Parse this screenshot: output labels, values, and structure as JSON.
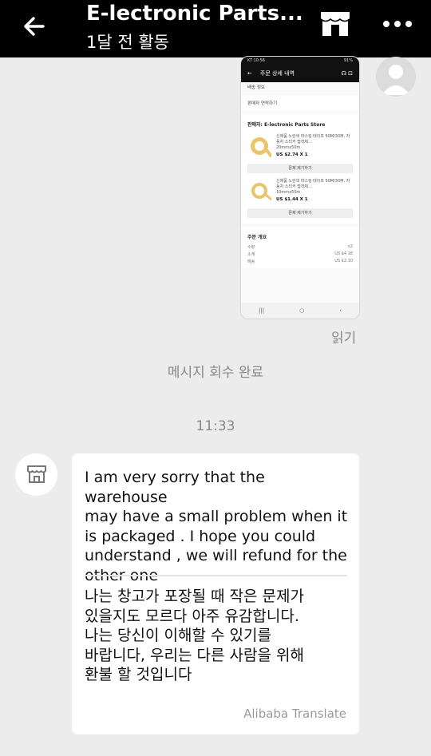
{
  "header": {
    "title": "E-lectronic Parts...",
    "subtitle": "1달 전 활동"
  },
  "screenshot": {
    "status_time": "KT 10:56",
    "status_right": "91%",
    "title": "주문 상세 내역",
    "shipping_info": "배송 정보",
    "contact_seller": "판매자 연락하기",
    "seller": "판매자: E-lectronic Parts Store",
    "items": [
      {
        "name": "신제품 노란색 마스킹 테이프 50M/30M, 자동차 스티커 접착제...",
        "variant": "20mmx50m",
        "price": "US $2.74 X 1",
        "button": "문제 제기하기"
      },
      {
        "name": "신제품 노란색 마스킹 테이프 50M/30M, 자동차 스티커 접착제...",
        "variant": "10mmx50m",
        "price": "US $1.44 X 1",
        "button": "문제 제기하기"
      }
    ],
    "summary_title": "주문 개요",
    "summary_rows": [
      {
        "label": "수량",
        "value": "x2"
      },
      {
        "label": "소계",
        "value": "US $4.18"
      },
      {
        "label": "배송",
        "value": "US $2.10"
      }
    ]
  },
  "chat": {
    "read_status": "읽기",
    "recall_notice": "메시지 회수 완료",
    "timestamp": "11:33",
    "message_en": "I am very sorry that the warehouse\nmay have a small problem when it\nis packaged . I hope you could\nunderstand ,  we will refund for the\nother one",
    "message_ko": "나는 창고가 포장될 때 작은 문제가\n있을지도 모르다 아주 유감합니다.\n나는 당신이 이해할 수 있기를\n바랍니다, 우리는 다른 사람을 위해\n환불 할 것입니다",
    "attribution": "Alibaba Translate"
  },
  "colors": {
    "topbar": "#000000",
    "background": "#ececec",
    "bubble": "#ffffff",
    "muted_text": "#888888"
  }
}
